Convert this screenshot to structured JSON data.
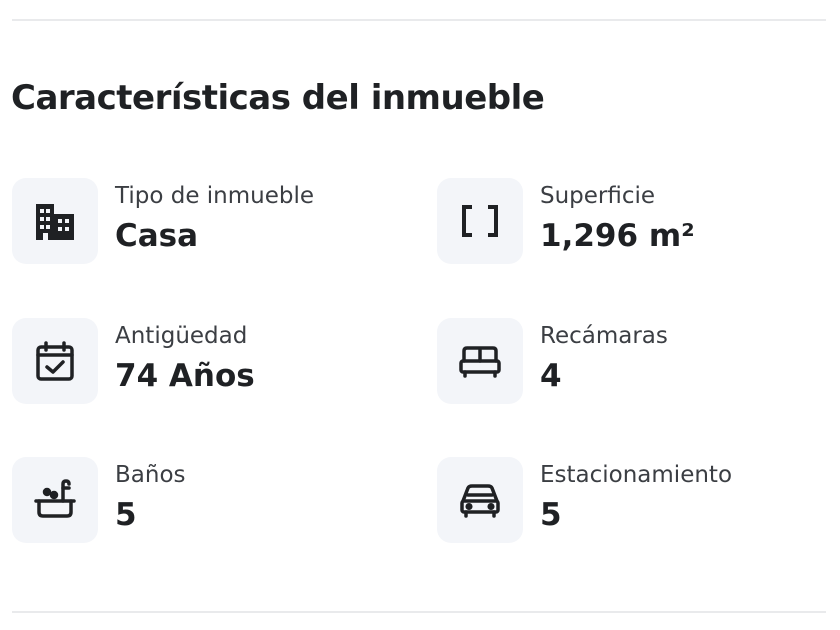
{
  "section": {
    "title": "Características del inmueble"
  },
  "features": [
    {
      "icon": "building-icon",
      "label": "Tipo de inmueble",
      "value": "Casa"
    },
    {
      "icon": "area-brackets-icon",
      "label": "Superficie",
      "value": "1,296 m²"
    },
    {
      "icon": "calendar-check-icon",
      "label": "Antigüedad",
      "value": "74 Años"
    },
    {
      "icon": "bed-icon",
      "label": "Recámaras",
      "value": "4"
    },
    {
      "icon": "bathtub-icon",
      "label": "Baños",
      "value": "5"
    },
    {
      "icon": "car-icon",
      "label": "Estacionamiento",
      "value": "5"
    }
  ],
  "colors": {
    "text": "#1f2124",
    "label": "#3b3e43",
    "icon_background": "#f3f5f9",
    "divider": "#e9eaec"
  }
}
